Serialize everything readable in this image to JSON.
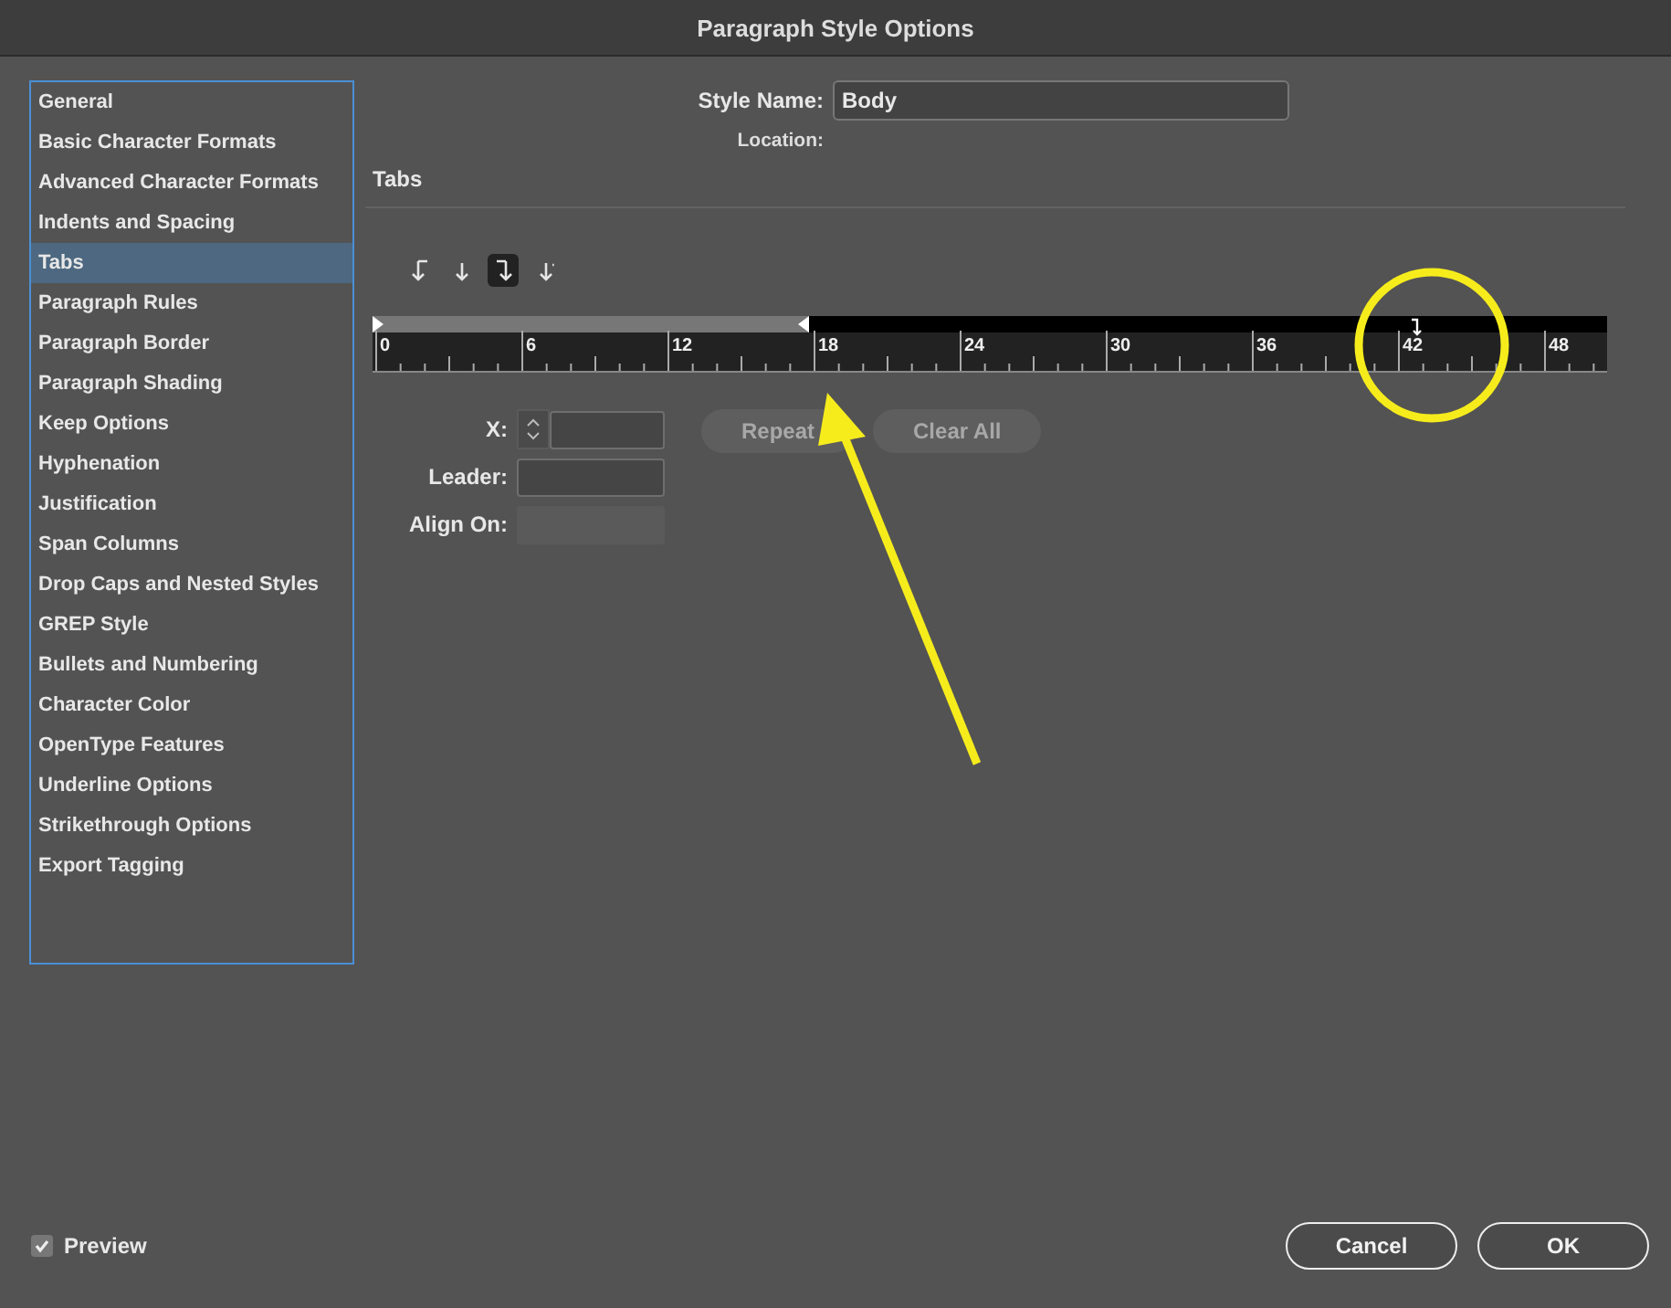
{
  "window": {
    "title": "Paragraph Style Options"
  },
  "sidebar": {
    "items": [
      {
        "label": "General",
        "selected": false
      },
      {
        "label": "Basic Character Formats",
        "selected": false
      },
      {
        "label": "Advanced Character Formats",
        "selected": false
      },
      {
        "label": "Indents and Spacing",
        "selected": false
      },
      {
        "label": "Tabs",
        "selected": true
      },
      {
        "label": "Paragraph Rules",
        "selected": false
      },
      {
        "label": "Paragraph Border",
        "selected": false
      },
      {
        "label": "Paragraph Shading",
        "selected": false
      },
      {
        "label": "Keep Options",
        "selected": false
      },
      {
        "label": "Hyphenation",
        "selected": false
      },
      {
        "label": "Justification",
        "selected": false
      },
      {
        "label": "Span Columns",
        "selected": false
      },
      {
        "label": "Drop Caps and Nested Styles",
        "selected": false
      },
      {
        "label": "GREP Style",
        "selected": false
      },
      {
        "label": "Bullets and Numbering",
        "selected": false
      },
      {
        "label": "Character Color",
        "selected": false
      },
      {
        "label": "OpenType Features",
        "selected": false
      },
      {
        "label": "Underline Options",
        "selected": false
      },
      {
        "label": "Strikethrough Options",
        "selected": false
      },
      {
        "label": "Export Tagging",
        "selected": false
      }
    ]
  },
  "style_name": {
    "label": "Style Name:",
    "value": "Body"
  },
  "location": {
    "label": "Location:"
  },
  "section_title": "Tabs",
  "tab_alignment_buttons": [
    {
      "kind": "left",
      "selected": false
    },
    {
      "kind": "center",
      "selected": false
    },
    {
      "kind": "right",
      "selected": true
    },
    {
      "kind": "decimal",
      "selected": false
    }
  ],
  "ruler": {
    "labels": [
      "0",
      "6",
      "12",
      "18",
      "24",
      "30",
      "36",
      "42",
      "48"
    ]
  },
  "fields": [
    {
      "kind": "stepper",
      "label": "X:"
    },
    {
      "kind": "text",
      "label": "Leader:"
    },
    {
      "kind": "disabled",
      "label": "Align On:"
    }
  ],
  "buttons": [
    {
      "label": "Repeat",
      "disabled": true
    },
    {
      "label": "Clear All",
      "disabled": true
    }
  ],
  "preview": {
    "label": "Preview",
    "checked": true
  },
  "footer_buttons": [
    {
      "label": "Cancel"
    },
    {
      "label": "OK"
    }
  ]
}
